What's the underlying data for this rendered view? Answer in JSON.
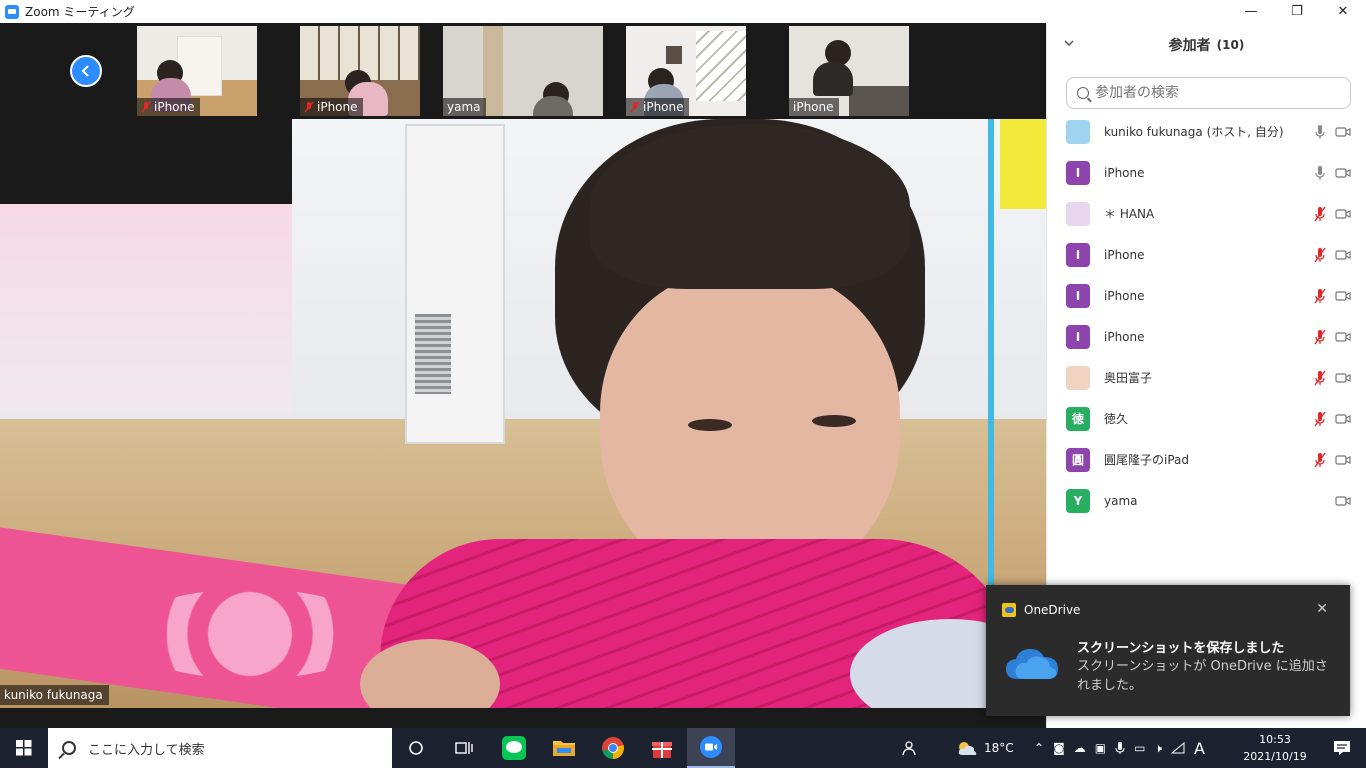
{
  "window": {
    "title": "Zoom ミーティング",
    "minimize": "—",
    "restore": "❐",
    "close": "✕"
  },
  "thumbnails": [
    {
      "name": "iPhone",
      "muted": true
    },
    {
      "name": "iPhone",
      "muted": true
    },
    {
      "name": "yama",
      "muted": false
    },
    {
      "name": "iPhone",
      "muted": true
    },
    {
      "name": "iPhone",
      "muted": false
    }
  ],
  "main_video": {
    "speaker_name": "kuniko fukunaga"
  },
  "participants_panel": {
    "title": "参加者",
    "count": "(10)",
    "search_placeholder": "参加者の検索",
    "participants": [
      {
        "name": "kuniko fukunaga (ホスト, 自分)",
        "avatar": "",
        "avatar_color": "#9fd3f0",
        "mic": "on"
      },
      {
        "name": "iPhone",
        "avatar": "I",
        "avatar_color": "#8e44ad",
        "mic": "on"
      },
      {
        "name": "＊ HANA",
        "avatar": "",
        "avatar_color": "#e8d6ee",
        "mic": "muted"
      },
      {
        "name": "iPhone",
        "avatar": "I",
        "avatar_color": "#8e44ad",
        "mic": "muted"
      },
      {
        "name": "iPhone",
        "avatar": "I",
        "avatar_color": "#8e44ad",
        "mic": "muted"
      },
      {
        "name": "iPhone",
        "avatar": "I",
        "avatar_color": "#8e44ad",
        "mic": "muted"
      },
      {
        "name": "奥田富子",
        "avatar": "",
        "avatar_color": "#f2d3c2",
        "mic": "muted"
      },
      {
        "name": "徳久",
        "avatar": "徳",
        "avatar_color": "#27ae60",
        "mic": "muted"
      },
      {
        "name": "圓尾隆子のiPad",
        "avatar": "圓",
        "avatar_color": "#8e44ad",
        "mic": "muted"
      },
      {
        "name": "yama",
        "avatar": "Y",
        "avatar_color": "#27ae60",
        "mic": "none"
      }
    ]
  },
  "toast": {
    "app": "OneDrive",
    "title": "スクリーンショットを保存しました",
    "body": "スクリーンショットが OneDrive に追加されました。"
  },
  "taskbar": {
    "search_text": "ここに入力して検索",
    "weather": "18°C",
    "ime": "A",
    "time": "10:53",
    "date": "2021/10/19"
  },
  "colors": {
    "accent": "#2d8cff",
    "muted_red": "#e02828",
    "taskbar": "#1c2230"
  }
}
